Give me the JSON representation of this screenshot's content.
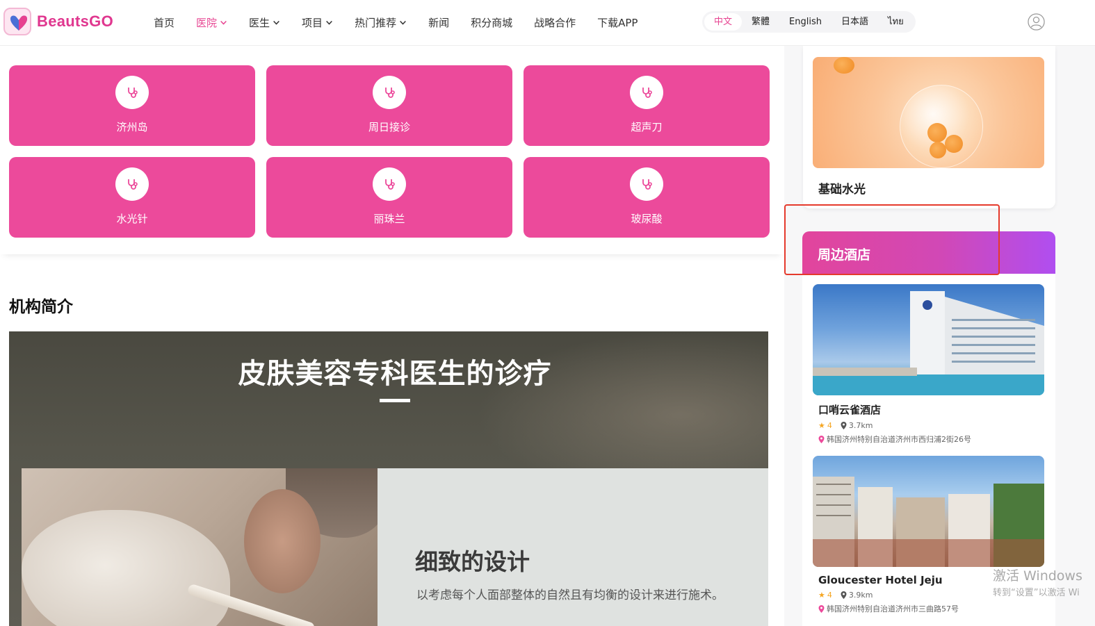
{
  "header": {
    "logo_text": "BeautsGO",
    "nav": [
      {
        "label": "首页"
      },
      {
        "label": "医院"
      },
      {
        "label": "医生"
      },
      {
        "label": "项目"
      },
      {
        "label": "热门推荐"
      },
      {
        "label": "新闻"
      },
      {
        "label": "积分商城"
      },
      {
        "label": "战略合作"
      },
      {
        "label": "下载APP"
      }
    ],
    "languages": [
      "中文",
      "繁體",
      "English",
      "日本語",
      "ไทย"
    ],
    "active_language": "中文"
  },
  "categories": [
    {
      "label": "济州岛"
    },
    {
      "label": "周日接诊"
    },
    {
      "label": "超声刀"
    },
    {
      "label": "水光针"
    },
    {
      "label": "丽珠兰"
    },
    {
      "label": "玻尿酸"
    }
  ],
  "intro": {
    "section_title": "机构简介",
    "heading": "皮肤美容专科医生的诊疗",
    "subheading": "细致的设计",
    "description": "以考虑每个人面部整体的自然且有均衡的设计来进行施术。"
  },
  "sidebar": {
    "top_card_title": "基础水光",
    "hotels_title": "周边酒店",
    "hotels": [
      {
        "name": "口哨云雀酒店",
        "rating": "4",
        "distance": "3.7km",
        "address": "韩国济州特别自治道济州市西归浦2街26号"
      },
      {
        "name": "Gloucester Hotel Jeju",
        "rating": "4",
        "distance": "3.9km",
        "address": "韩国济州特别自治道济州市三曲路57号"
      }
    ]
  },
  "watermark": {
    "line1": "激活 Windows",
    "line2": "转到“设置”以激活 Wi"
  },
  "colors": {
    "brand_pink": "#ec4a9b",
    "active_text": "#e74592",
    "highlight_border": "#e53a2c"
  }
}
